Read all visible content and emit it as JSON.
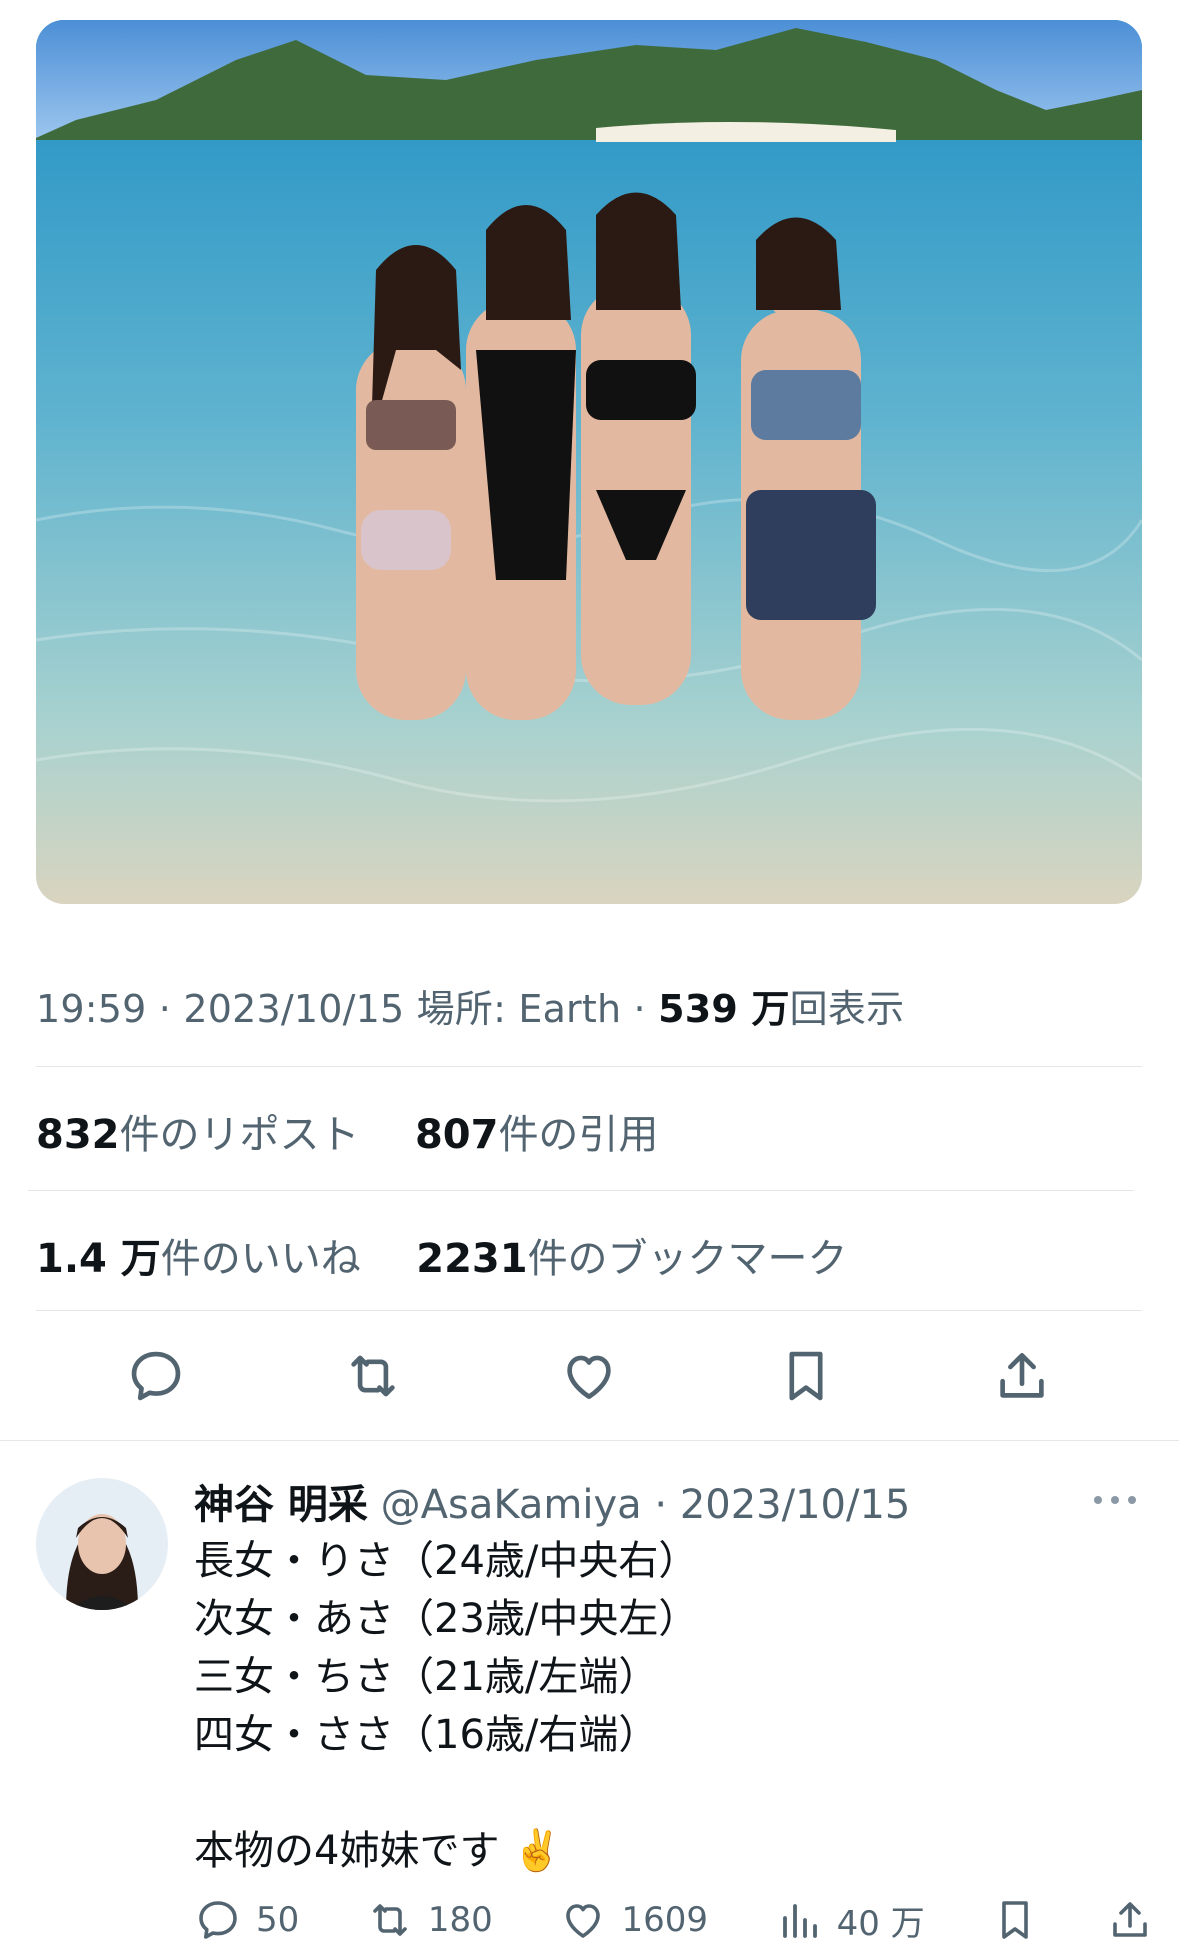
{
  "tweet": {
    "time": "19:59",
    "date": "2023/10/15",
    "location": "場所: Earth",
    "views_count": "539 万",
    "views_label": "回表示"
  },
  "stats": {
    "reposts_count": "832",
    "reposts_label": "件のリポスト",
    "quotes_count": "807",
    "quotes_label": "件の引用",
    "likes_count": "1.4 万",
    "likes_label": "件のいいね",
    "bookmarks_count": "2231",
    "bookmarks_label": "件のブックマーク"
  },
  "actions": [
    "reply-icon",
    "repost-icon",
    "like-icon",
    "bookmark-icon",
    "share-icon"
  ],
  "reply": {
    "name": "神谷 明采",
    "handle": "@AsaKamiya",
    "date": "· 2023/10/15",
    "text": "長女・りさ（24歳/中央右）\n次女・あさ（23歳/中央左）\n三女・ちさ（21歳/左端）\n四女・ささ（16歳/右端）\n\n本物の4姉妹です ✌️",
    "replies": "50",
    "reposts": "180",
    "likes": "1609",
    "views": "40 万"
  },
  "colors": {
    "text": "#0f1419",
    "secondary": "#536471",
    "divider": "#e4e8eb"
  }
}
